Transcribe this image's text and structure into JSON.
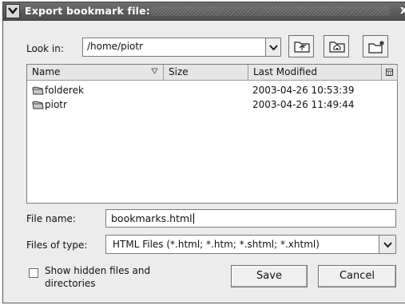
{
  "window": {
    "title": "Export bookmark file:",
    "close_glyph": "x"
  },
  "lookin": {
    "label": "Look in:",
    "path": "/home/piotr"
  },
  "toolbar": {
    "icons": [
      "up-one-level-icon",
      "home-icon",
      "new-folder-icon"
    ]
  },
  "list": {
    "columns": [
      "Name",
      "Size",
      "Last Modified"
    ],
    "rows": [
      {
        "name": "folderek",
        "size": "",
        "modified": "2003-04-26 10:53:39"
      },
      {
        "name": "piotr",
        "size": "",
        "modified": "2003-04-26 11:49:44"
      }
    ]
  },
  "filename": {
    "label": "File name:",
    "value": "bookmarks.html"
  },
  "filetype": {
    "label": "Files of type:",
    "value": "HTML Files (*.html; *.htm; *.shtml; *.xhtml)"
  },
  "hidden_files": {
    "label": "Show hidden files and directories",
    "checked": false
  },
  "buttons": {
    "save": "Save",
    "cancel": "Cancel"
  }
}
